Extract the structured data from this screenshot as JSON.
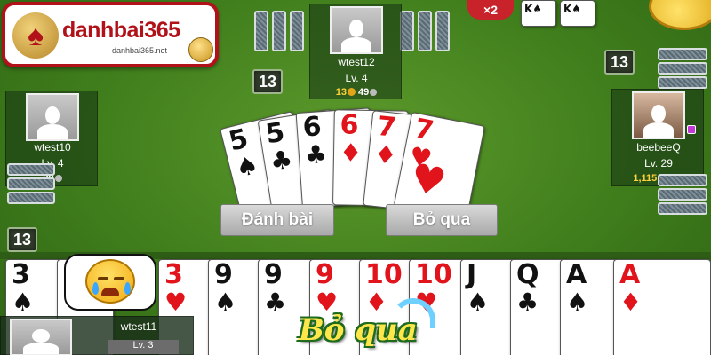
{
  "logo": {
    "text": "danhbai365",
    "subtext": "danhbai365.net",
    "badge_symbol": "♠"
  },
  "multiplier": "×2",
  "mini_cards": [
    {
      "rank": "K",
      "suit": "♠",
      "color": "black"
    },
    {
      "rank": "K",
      "suit": "♠",
      "color": "black"
    }
  ],
  "players": {
    "top": {
      "name": "wtest12",
      "level": "Lv. 4",
      "coins": "13",
      "chips": "49",
      "cards_left": "13"
    },
    "left": {
      "name": "wtest10",
      "level": "Lv. 4",
      "coins": "39",
      "cards_left": "13"
    },
    "right": {
      "name": "beebeeQ",
      "level": "Lv. 29",
      "coins": "1,115,514",
      "cards_left": "13"
    },
    "self": {
      "name": "wtest11",
      "level": "Lv. 3",
      "cards_left": "13"
    }
  },
  "played_cards": [
    {
      "rank": "5",
      "suit": "♠",
      "color": "black"
    },
    {
      "rank": "5",
      "suit": "♣",
      "color": "black"
    },
    {
      "rank": "6",
      "suit": "♣",
      "color": "black"
    },
    {
      "rank": "6",
      "suit": "♦",
      "color": "red"
    },
    {
      "rank": "7",
      "suit": "♦",
      "color": "red"
    },
    {
      "rank": "7",
      "suit": "♥",
      "color": "red"
    }
  ],
  "hand_cards": [
    {
      "rank": "3",
      "suit": "♠",
      "color": "black"
    },
    {
      "rank": "3",
      "suit": "",
      "color": "black"
    },
    {
      "rank": "3",
      "suit": "♥",
      "color": "red"
    },
    {
      "rank": "9",
      "suit": "♠",
      "color": "black"
    },
    {
      "rank": "9",
      "suit": "♣",
      "color": "black"
    },
    {
      "rank": "9",
      "suit": "♥",
      "color": "red"
    },
    {
      "rank": "10",
      "suit": "♦",
      "color": "red"
    },
    {
      "rank": "10",
      "suit": "♥",
      "color": "red"
    },
    {
      "rank": "J",
      "suit": "♠",
      "color": "black"
    },
    {
      "rank": "Q",
      "suit": "♣",
      "color": "black"
    },
    {
      "rank": "A",
      "suit": "♠",
      "color": "black"
    },
    {
      "rank": "A",
      "suit": "♦",
      "color": "red"
    }
  ],
  "buttons": {
    "play": "Đánh bài",
    "pass": "Bỏ qua"
  },
  "pass_banner": "Bỏ qua",
  "colors": {
    "table": "#3f7d1c",
    "logo_red": "#b1121a",
    "coin": "#ffd23a"
  }
}
